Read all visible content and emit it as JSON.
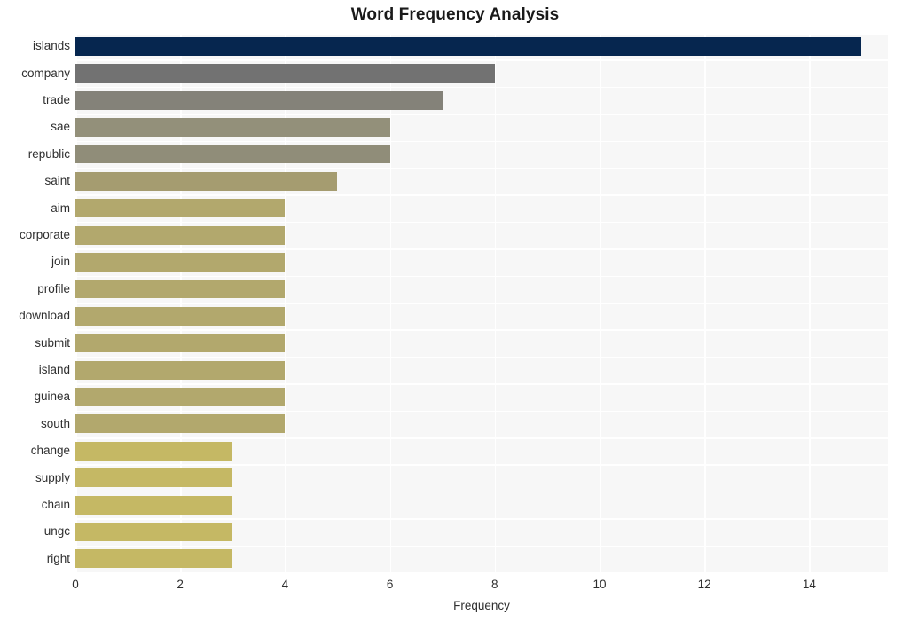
{
  "chart_data": {
    "type": "bar",
    "orientation": "horizontal",
    "title": "Word Frequency Analysis",
    "xlabel": "Frequency",
    "ylabel": "",
    "categories": [
      "islands",
      "company",
      "trade",
      "sae",
      "republic",
      "saint",
      "aim",
      "corporate",
      "join",
      "profile",
      "download",
      "submit",
      "island",
      "guinea",
      "south",
      "change",
      "supply",
      "chain",
      "ungc",
      "right"
    ],
    "values": [
      15,
      8,
      7,
      6,
      6,
      5,
      4,
      4,
      4,
      4,
      4,
      4,
      4,
      4,
      4,
      3,
      3,
      3,
      3,
      3
    ],
    "bar_colors": [
      "#06264f",
      "#727272",
      "#848279",
      "#93907a",
      "#908d79",
      "#a59c70",
      "#b2a86d",
      "#b2a86d",
      "#b2a86d",
      "#b2a86d",
      "#b2a86d",
      "#b2a86d",
      "#b2a86d",
      "#b2a86d",
      "#b2a86d",
      "#c5b864",
      "#c5b864",
      "#c5b864",
      "#c5b864",
      "#c5b864"
    ],
    "xlim": [
      0,
      15.5
    ],
    "xticks": [
      0,
      2,
      4,
      6,
      8,
      10,
      12,
      14
    ],
    "xtick_labels": [
      "0",
      "2",
      "4",
      "6",
      "8",
      "10",
      "12",
      "14"
    ],
    "grid": true,
    "grid_color": "#ffffff",
    "plot_background": "#f7f7f7",
    "figure_background": "#ffffff",
    "legend": null
  }
}
